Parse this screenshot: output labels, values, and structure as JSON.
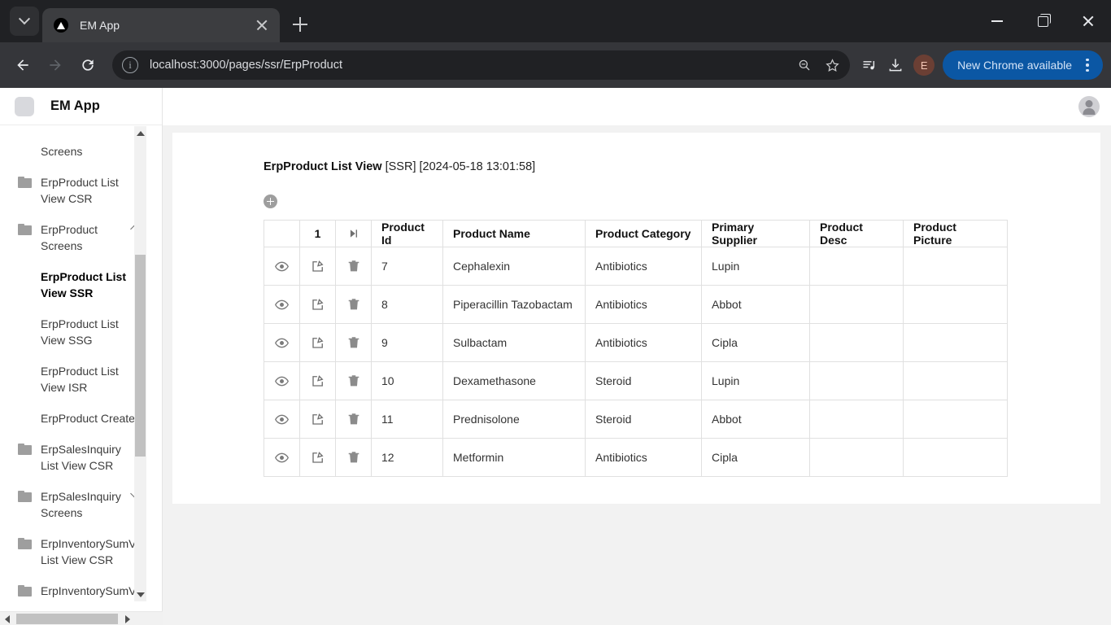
{
  "browser": {
    "tab": {
      "title": "EM App",
      "favicon": "nextjs-triangle-icon"
    },
    "url": "localhost:3000/pages/ssr/ErpProduct",
    "update_button": "New Chrome available",
    "profile_initial": "E"
  },
  "sidebar": {
    "app_name": "EM App",
    "items": [
      {
        "label": "Screens",
        "type": "plain",
        "icon": "none",
        "chevron": "none",
        "active": false
      },
      {
        "label": "ErpProduct List View CSR",
        "type": "folder",
        "icon": "folder-icon",
        "chevron": "none",
        "active": false
      },
      {
        "label": "ErpProduct Screens",
        "type": "folder",
        "icon": "folder-icon",
        "chevron": "up",
        "active": false
      },
      {
        "label": "ErpProduct List View SSR",
        "type": "child",
        "icon": "none",
        "chevron": "none",
        "active": true
      },
      {
        "label": "ErpProduct List View SSG",
        "type": "child",
        "icon": "none",
        "chevron": "none",
        "active": false
      },
      {
        "label": "ErpProduct List View ISR",
        "type": "child",
        "icon": "none",
        "chevron": "none",
        "active": false
      },
      {
        "label": "ErpProduct Create",
        "type": "child",
        "icon": "none",
        "chevron": "none",
        "active": false
      },
      {
        "label": "ErpSalesInquiry List View CSR",
        "type": "folder",
        "icon": "folder-icon",
        "chevron": "none",
        "active": false
      },
      {
        "label": "ErpSalesInquiry Screens",
        "type": "folder",
        "icon": "folder-icon",
        "chevron": "down",
        "active": false
      },
      {
        "label": "ErpInventorySumVw List View CSR",
        "type": "folder",
        "icon": "folder-icon",
        "chevron": "none",
        "active": false
      },
      {
        "label": "ErpInventorySumVw",
        "type": "folder",
        "icon": "folder-icon",
        "chevron": "none",
        "active": false
      }
    ]
  },
  "main": {
    "title_bold": "ErpProduct List View",
    "title_meta": " [SSR] [2024-05-18 13:01:58]",
    "add_button_label": "add-row",
    "pagination": {
      "page": "1",
      "next_icon": "skip-next-icon"
    },
    "table": {
      "headers": [
        "",
        "1",
        "",
        "Product Id",
        "Product Name",
        "Product Category",
        "Primary Supplier",
        "Product Desc",
        "Product Picture"
      ],
      "rows": [
        {
          "product_id": "7",
          "product_name": "Cephalexin",
          "product_category": "Antibiotics",
          "primary_supplier": "Lupin",
          "product_desc": "",
          "product_picture": ""
        },
        {
          "product_id": "8",
          "product_name": "Piperacillin Tazobactam",
          "product_category": "Antibiotics",
          "primary_supplier": "Abbot",
          "product_desc": "",
          "product_picture": ""
        },
        {
          "product_id": "9",
          "product_name": "Sulbactam",
          "product_category": "Antibiotics",
          "primary_supplier": "Cipla",
          "product_desc": "",
          "product_picture": ""
        },
        {
          "product_id": "10",
          "product_name": "Dexamethasone",
          "product_category": "Steroid",
          "primary_supplier": "Lupin",
          "product_desc": "",
          "product_picture": ""
        },
        {
          "product_id": "11",
          "product_name": "Prednisolone",
          "product_category": "Steroid",
          "primary_supplier": "Abbot",
          "product_desc": "",
          "product_picture": ""
        },
        {
          "product_id": "12",
          "product_name": "Metformin",
          "product_category": "Antibiotics",
          "primary_supplier": "Cipla",
          "product_desc": "",
          "product_picture": ""
        }
      ],
      "row_actions": [
        "view-icon",
        "edit-icon",
        "delete-icon"
      ]
    }
  },
  "colors": {
    "chrome_tabstrip": "#202124",
    "chrome_toolbar": "#35363a",
    "update_button": "#0b57a4",
    "page_background": "#f2f2f2",
    "table_border": "#e0e0e0"
  }
}
